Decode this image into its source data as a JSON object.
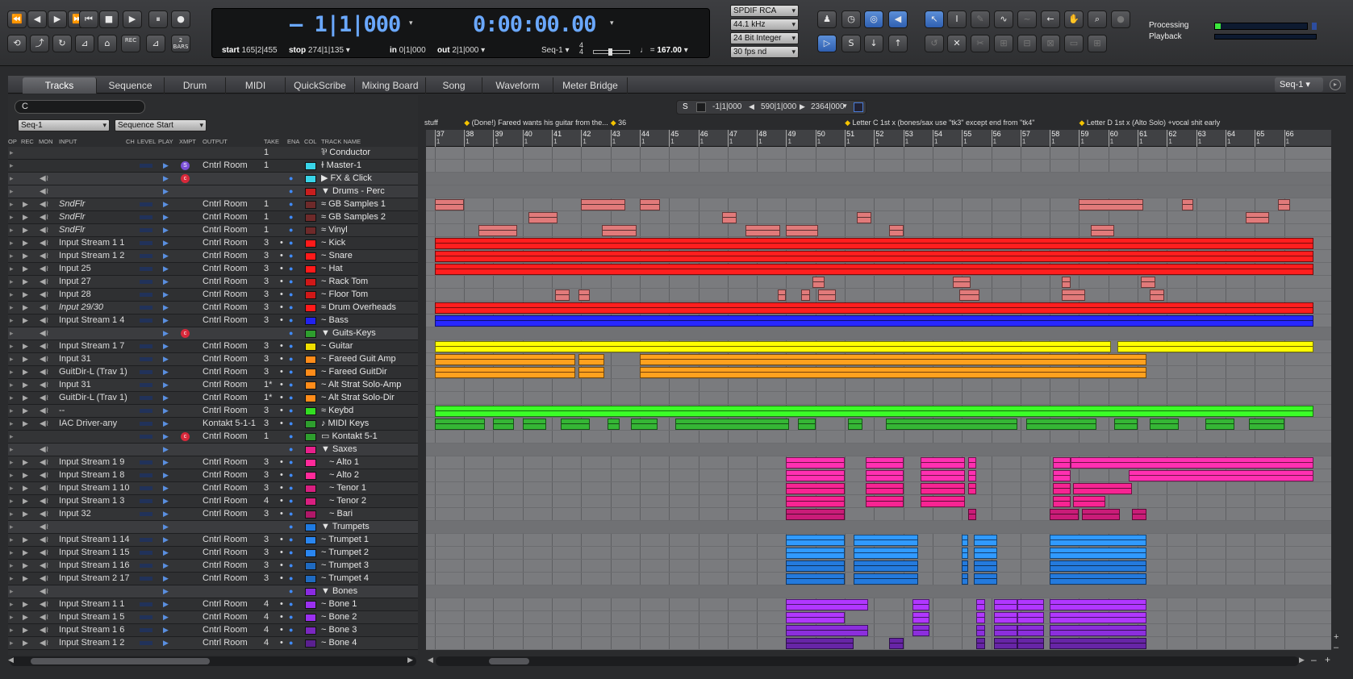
{
  "transport": {
    "buttons": [
      "⏪",
      "◀",
      "▶",
      "⏩",
      "⏮",
      "■",
      "▶",
      "⏸",
      "●"
    ],
    "row2_buttons": [
      "2 BARS"
    ],
    "position_bars": "– 1|1|000",
    "position_time": "0:00:00.00",
    "start": "165|2|455",
    "stop": "274|1|135",
    "in_point": "0|1|000",
    "out_point": "2|1|000",
    "start_label": "start",
    "stop_label": "stop",
    "in_label": "in",
    "out_label": "out",
    "sequence": "Seq-1",
    "meter_top": "4",
    "meter_bottom": "4",
    "tempo": "167.00",
    "tempo_eq": "="
  },
  "sync": {
    "clock_source": "SPDIF RCA",
    "sample_rate": "44.1 kHz",
    "bit_depth": "24 Bit Integer",
    "frame_rate": "30 fps nd"
  },
  "status": {
    "processing_label": "Processing",
    "playback_label": "Playback",
    "processing_level": 0.06
  },
  "tabs": [
    "Tracks",
    "Sequence",
    "Drum",
    "MIDI",
    "QuickScribe",
    "Mixing Board",
    "Song",
    "Waveform",
    "Meter Bridge"
  ],
  "active_tab": "Tracks",
  "tabbar_right": "Seq-1",
  "filter": {
    "value": "C"
  },
  "seq_menu": "Seq-1",
  "seq_start_menu": "Sequence Start",
  "selection": {
    "s_label": "S",
    "start": "-1|1|000",
    "end": "590|1|000",
    "length": "2364|000"
  },
  "columns": [
    "OP",
    "REC",
    "MON",
    "INPUT",
    "CH",
    "LEVEL",
    "PLAY",
    "XMPT",
    "OUTPUT",
    "TAKE",
    "ENA",
    "COL",
    "TRACK NAME"
  ],
  "tracks": [
    {
      "input": "",
      "out": "",
      "take": "1",
      "dot": "",
      "name": "Conductor",
      "color": "",
      "icon": "⅌",
      "folder": false
    },
    {
      "input": "",
      "out": "Cntrl Room",
      "take": "1",
      "dot": "",
      "name": "Master-1",
      "color": "#39d4e8",
      "icon": "ɫ",
      "folder": false,
      "xmpt": "S"
    },
    {
      "input": "",
      "out": "",
      "take": "",
      "dot": "",
      "name": "FX & Click",
      "color": "#39d4e8",
      "icon": "▶",
      "folder": true,
      "xmpt": "c"
    },
    {
      "input": "",
      "out": "",
      "take": "",
      "dot": "",
      "name": "Drums - Perc",
      "color": "#c81e1e",
      "icon": "▼",
      "folder": true
    },
    {
      "input": "SndFlr",
      "it": true,
      "out": "Cntrl Room",
      "take": "1",
      "dot": "",
      "name": "GB Samples 1",
      "color": "#6e2a2a",
      "icon": "≈",
      "folder": false
    },
    {
      "input": "SndFlr",
      "it": true,
      "out": "Cntrl Room",
      "take": "1",
      "dot": "",
      "name": "GB Samples 2",
      "color": "#6e2a2a",
      "icon": "≈",
      "folder": false
    },
    {
      "input": "SndFlr",
      "it": true,
      "out": "Cntrl Room",
      "take": "1",
      "dot": "",
      "name": "Vinyl",
      "color": "#6e2a2a",
      "icon": "≈",
      "folder": false
    },
    {
      "input": "Input Stream 1 1",
      "out": "Cntrl Room",
      "take": "3",
      "dot": "•",
      "name": "Kick",
      "color": "#ff1a1a",
      "icon": "~",
      "folder": false
    },
    {
      "input": "Input Stream 1 2",
      "out": "Cntrl Room",
      "take": "3",
      "dot": "•",
      "name": "Snare",
      "color": "#ff1a1a",
      "icon": "~",
      "folder": false
    },
    {
      "input": "Input 25",
      "out": "Cntrl Room",
      "take": "3",
      "dot": "•",
      "name": "Hat",
      "color": "#ff1a1a",
      "icon": "~",
      "folder": false
    },
    {
      "input": "Input 27",
      "out": "Cntrl Room",
      "take": "3",
      "dot": "•",
      "name": "Rack Tom",
      "color": "#d01818",
      "icon": "~",
      "folder": false
    },
    {
      "input": "Input 28",
      "out": "Cntrl Room",
      "take": "3",
      "dot": "•",
      "name": "Floor Tom",
      "color": "#d01818",
      "icon": "~",
      "folder": false
    },
    {
      "input": "Input 29/30",
      "it": true,
      "out": "Cntrl Room",
      "take": "3",
      "dot": "•",
      "name": "Drum Overheads",
      "color": "#ff1a1a",
      "icon": "≈",
      "folder": false
    },
    {
      "input": "Input Stream 1 4",
      "out": "Cntrl Room",
      "take": "3",
      "dot": "•",
      "name": "Bass",
      "color": "#2222ee",
      "icon": "~",
      "folder": false
    },
    {
      "input": "",
      "out": "",
      "take": "",
      "dot": "",
      "name": "Guits-Keys",
      "color": "#2e9e2e",
      "icon": "▼",
      "folder": true,
      "xmpt": "c"
    },
    {
      "input": "Input Stream 1 7",
      "out": "Cntrl Room",
      "take": "3",
      "dot": "•",
      "name": "Guitar",
      "color": "#eedd00",
      "icon": "~",
      "folder": false
    },
    {
      "input": "Input 31",
      "out": "Cntrl Room",
      "take": "3",
      "dot": "•",
      "name": "Fareed Guit Amp",
      "color": "#ff8c1a",
      "icon": "~",
      "folder": false
    },
    {
      "input": "GuitDir-L (Trav 1)",
      "out": "Cntrl Room",
      "take": "3",
      "dot": "•",
      "name": "Fareed GuitDir",
      "color": "#ff8c1a",
      "icon": "~",
      "folder": false
    },
    {
      "input": "Input 31",
      "out": "Cntrl Room",
      "take": "1*",
      "dot": "•",
      "name": "Alt Strat Solo-Amp",
      "color": "#ff8c1a",
      "icon": "~",
      "folder": false
    },
    {
      "input": "GuitDir-L (Trav 1)",
      "out": "Cntrl Room",
      "take": "1*",
      "dot": "•",
      "name": "Alt Strat Solo-Dir",
      "color": "#ff8c1a",
      "icon": "~",
      "folder": false
    },
    {
      "input": "--",
      "out": "Cntrl Room",
      "take": "3",
      "dot": "•",
      "name": "Keybd",
      "color": "#33dd22",
      "icon": "≈",
      "folder": false
    },
    {
      "input": "IAC Driver-any",
      "out": "Kontakt 5-1-1",
      "take": "3",
      "dot": "•",
      "name": "MIDI Keys",
      "color": "#2e9e2e",
      "icon": "♪",
      "folder": false
    },
    {
      "input": "",
      "out": "Cntrl Room",
      "take": "1",
      "dot": "",
      "name": "Kontakt 5-1",
      "color": "#2e9e2e",
      "icon": "▭",
      "folder": false,
      "xmpt": "c"
    },
    {
      "input": "",
      "out": "",
      "take": "",
      "dot": "",
      "name": "Saxes",
      "color": "#e8208c",
      "icon": "▼",
      "folder": true
    },
    {
      "input": "Input Stream 1 9",
      "out": "Cntrl Room",
      "take": "3",
      "dot": "•",
      "name": "Alto 1",
      "color": "#ff2a9a",
      "icon": "~",
      "folder": false,
      "indent": true
    },
    {
      "input": "Input Stream 1 8",
      "out": "Cntrl Room",
      "take": "3",
      "dot": "•",
      "name": "Alto 2",
      "color": "#ff2a9a",
      "icon": "~",
      "folder": false,
      "indent": true
    },
    {
      "input": "Input Stream 1 10",
      "out": "Cntrl Room",
      "take": "3",
      "dot": "•",
      "name": "Tenor 1",
      "color": "#d81f80",
      "icon": "~",
      "folder": false,
      "indent": true
    },
    {
      "input": "Input Stream 1 3",
      "out": "Cntrl Room",
      "take": "4",
      "dot": "•",
      "name": "Tenor 2",
      "color": "#d81f80",
      "icon": "~",
      "folder": false,
      "indent": true
    },
    {
      "input": "Input 32",
      "out": "Cntrl Room",
      "take": "3",
      "dot": "•",
      "name": "Bari",
      "color": "#b01868",
      "icon": "~",
      "folder": false,
      "indent": true
    },
    {
      "input": "",
      "out": "",
      "take": "",
      "dot": "",
      "name": "Trumpets",
      "color": "#1f7ae0",
      "icon": "▼",
      "folder": true
    },
    {
      "input": "Input Stream 1 14",
      "out": "Cntrl Room",
      "take": "3",
      "dot": "•",
      "name": "Trumpet 1",
      "color": "#2a86f0",
      "icon": "~",
      "folder": false
    },
    {
      "input": "Input Stream 1 15",
      "out": "Cntrl Room",
      "take": "3",
      "dot": "•",
      "name": "Trumpet 2",
      "color": "#2a86f0",
      "icon": "~",
      "folder": false
    },
    {
      "input": "Input Stream 1 16",
      "out": "Cntrl Room",
      "take": "3",
      "dot": "•",
      "name": "Trumpet 3",
      "color": "#1f6ac0",
      "icon": "~",
      "folder": false
    },
    {
      "input": "Input Stream 2 17",
      "out": "Cntrl Room",
      "take": "3",
      "dot": "•",
      "name": "Trumpet 4",
      "color": "#1f6ac0",
      "icon": "~",
      "folder": false
    },
    {
      "input": "",
      "out": "",
      "take": "",
      "dot": "",
      "name": "Bones",
      "color": "#8a2be2",
      "icon": "▼",
      "folder": true
    },
    {
      "input": "Input Stream 1 1",
      "out": "Cntrl Room",
      "take": "4",
      "dot": "•",
      "name": "Bone 1",
      "color": "#9a30f0",
      "icon": "~",
      "folder": false
    },
    {
      "input": "Input Stream 1 5",
      "out": "Cntrl Room",
      "take": "4",
      "dot": "•",
      "name": "Bone 2",
      "color": "#9a30f0",
      "icon": "~",
      "folder": false
    },
    {
      "input": "Input Stream 1 6",
      "out": "Cntrl Room",
      "take": "4",
      "dot": "•",
      "name": "Bone 3",
      "color": "#7a28c0",
      "icon": "~",
      "folder": false
    },
    {
      "input": "Input Stream 1 2",
      "out": "Cntrl Room",
      "take": "4",
      "dot": "•",
      "name": "Bone 4",
      "color": "#5a2090",
      "icon": "~",
      "folder": false
    }
  ],
  "ruler": {
    "measures": [
      "37",
      "38",
      "39",
      "40",
      "41",
      "42",
      "43",
      "44",
      "45",
      "46",
      "47",
      "48",
      "49",
      "50",
      "51",
      "52",
      "53",
      "54",
      "55",
      "56",
      "57",
      "58",
      "59",
      "60",
      "61",
      "62",
      "63",
      "64",
      "65",
      "66"
    ],
    "beat_label": "1"
  },
  "markers": [
    {
      "text": "stuff",
      "measure": 36.7
    },
    {
      "text": "(Done!) Fareed wants his guitar from the...",
      "measure": 38.0
    },
    {
      "text": "36",
      "measure": 43.0
    },
    {
      "text": "Letter C 1st x  (bones/sax use \"tk3\" except end from \"tk4\"",
      "measure": 51.0
    },
    {
      "text": "Letter D 1st x (Alto Solo) +vocal shit early",
      "measure": 59.0
    }
  ],
  "lane_clips": [
    [],
    [],
    [],
    [],
    [
      [
        37,
        38
      ],
      [
        42,
        43.5
      ],
      [
        44,
        44.7
      ],
      [
        59,
        61.2
      ],
      [
        62.5,
        62.9
      ],
      [
        65.8,
        66.2
      ]
    ],
    [
      [
        40.2,
        41.2
      ],
      [
        46.8,
        47.3
      ],
      [
        51.4,
        51.9
      ],
      [
        64.7,
        65.5
      ]
    ],
    [
      [
        38.5,
        39.8
      ],
      [
        42.7,
        43.9
      ],
      [
        47.6,
        48.8
      ],
      [
        49,
        50.1
      ],
      [
        52.5,
        53
      ],
      [
        59.4,
        60.2
      ]
    ],
    [
      [
        37,
        67
      ]
    ],
    [
      [
        37,
        67
      ]
    ],
    [
      [
        37,
        67
      ]
    ],
    [
      [
        49.9,
        50.3
      ],
      [
        54.7,
        55.3
      ],
      [
        58.4,
        58.7
      ],
      [
        61.1,
        61.6
      ]
    ],
    [
      [
        41.1,
        41.6
      ],
      [
        41.9,
        42.3
      ],
      [
        48.7,
        49
      ],
      [
        49.5,
        49.8
      ],
      [
        50.1,
        50.7
      ],
      [
        54.9,
        55.6
      ],
      [
        58.4,
        59.2
      ],
      [
        61.4,
        61.9
      ]
    ],
    [
      [
        37,
        67
      ]
    ],
    [
      [
        37,
        67
      ]
    ],
    [],
    [
      [
        37,
        60.1
      ],
      [
        60.3,
        67
      ]
    ],
    [
      [
        37,
        41.8
      ],
      [
        41.9,
        42.8
      ],
      [
        44,
        61.3
      ]
    ],
    [
      [
        37,
        41.8
      ],
      [
        41.9,
        42.8
      ],
      [
        44,
        61.3
      ]
    ],
    [],
    [],
    [
      [
        37,
        67
      ]
    ],
    [
      [
        37,
        38.7
      ],
      [
        39,
        39.7
      ],
      [
        40,
        40.8
      ],
      [
        41.3,
        42.3
      ],
      [
        42.9,
        43.3
      ],
      [
        43.7,
        44.6
      ],
      [
        45.2,
        49.1
      ],
      [
        49.4,
        50
      ],
      [
        51.1,
        51.6
      ],
      [
        52.4,
        56.9
      ],
      [
        57.2,
        59.6
      ],
      [
        60.2,
        61
      ],
      [
        61.4,
        62.4
      ],
      [
        63.3,
        64.3
      ],
      [
        64.8,
        66
      ]
    ],
    [],
    [],
    [
      [
        49,
        51
      ],
      [
        51.7,
        53
      ],
      [
        53.6,
        55.1
      ],
      [
        55.2,
        55.5
      ],
      [
        58.1,
        58.7
      ],
      [
        58.7,
        67
      ]
    ],
    [
      [
        49,
        51
      ],
      [
        51.7,
        53
      ],
      [
        53.6,
        55.1
      ],
      [
        55.2,
        55.5
      ],
      [
        58.1,
        58.7
      ],
      [
        60.7,
        67
      ]
    ],
    [
      [
        49,
        51
      ],
      [
        51.7,
        53
      ],
      [
        53.6,
        55.1
      ],
      [
        55.2,
        55.5
      ],
      [
        58.1,
        58.7
      ],
      [
        58.8,
        60.8
      ]
    ],
    [
      [
        49,
        51
      ],
      [
        51.7,
        53
      ],
      [
        53.6,
        55.1
      ],
      [
        58.1,
        58.7
      ],
      [
        58.8,
        59.9
      ]
    ],
    [
      [
        49,
        51
      ],
      [
        55.2,
        55.5
      ],
      [
        58,
        59
      ],
      [
        59.1,
        60.4
      ],
      [
        60.8,
        61.3
      ]
    ],
    [],
    [
      [
        49,
        51
      ],
      [
        51.3,
        53.5
      ],
      [
        55,
        55.2
      ],
      [
        55.4,
        56.2
      ],
      [
        58,
        61.3
      ]
    ],
    [
      [
        49,
        51
      ],
      [
        51.3,
        53.5
      ],
      [
        55,
        55.2
      ],
      [
        55.4,
        56.2
      ],
      [
        58,
        61.3
      ]
    ],
    [
      [
        49,
        51
      ],
      [
        51.3,
        53.5
      ],
      [
        55,
        55.2
      ],
      [
        55.4,
        56.2
      ],
      [
        58,
        61.3
      ]
    ],
    [
      [
        49,
        51
      ],
      [
        51.3,
        53.5
      ],
      [
        55,
        55.2
      ],
      [
        55.4,
        56.2
      ],
      [
        58,
        61.3
      ]
    ],
    [],
    [
      [
        49,
        51.8
      ],
      [
        53.3,
        53.9
      ],
      [
        55.5,
        55.8
      ],
      [
        56.1,
        56.9
      ],
      [
        56.9,
        57.8
      ],
      [
        58,
        61.3
      ]
    ],
    [
      [
        49,
        51
      ],
      [
        53.3,
        53.9
      ],
      [
        55.5,
        55.8
      ],
      [
        56.1,
        56.9
      ],
      [
        56.9,
        57.8
      ],
      [
        58,
        61.3
      ]
    ],
    [
      [
        49,
        51.8
      ],
      [
        53.3,
        53.9
      ],
      [
        55.5,
        55.8
      ],
      [
        56.1,
        56.9
      ],
      [
        56.9,
        57.8
      ],
      [
        58,
        61.3
      ]
    ],
    [
      [
        49,
        51.3
      ],
      [
        52.5,
        53
      ],
      [
        55.5,
        55.8
      ],
      [
        56.1,
        56.9
      ],
      [
        56.9,
        57.8
      ],
      [
        58,
        61.3
      ]
    ]
  ]
}
